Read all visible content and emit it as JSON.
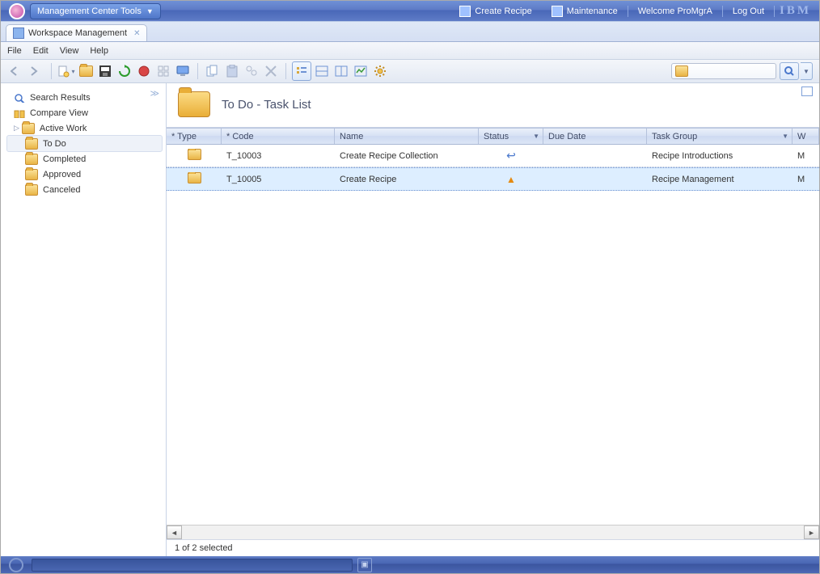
{
  "topbar": {
    "app_menu_label": "Management Center Tools",
    "link_create": "Create Recipe",
    "link_maintenance": "Maintenance",
    "welcome": "Welcome ProMgrA",
    "logout": "Log Out",
    "brand": "IBM"
  },
  "tab": {
    "label": "Workspace Management"
  },
  "menubar": {
    "file": "File",
    "edit": "Edit",
    "view": "View",
    "help": "Help"
  },
  "sidebar": {
    "search_results": "Search Results",
    "compare_view": "Compare View",
    "active_work": "Active Work",
    "to_do": "To Do",
    "completed": "Completed",
    "approved": "Approved",
    "canceled": "Canceled"
  },
  "panel": {
    "title": "To Do - Task List",
    "status_text": "1 of 2 selected",
    "headers": {
      "type": "* Type",
      "code": "* Code",
      "name": "Name",
      "status": "Status",
      "due": "Due Date",
      "group": "Task Group",
      "last": "W"
    },
    "rows": [
      {
        "code": "T_10003",
        "name": "Create Recipe Collection",
        "status_icon": "arrow",
        "group": "Recipe Introductions",
        "last": "M"
      },
      {
        "code": "T_10005",
        "name": "Create Recipe",
        "status_icon": "warn",
        "group": "Recipe Management",
        "last": "M"
      }
    ]
  }
}
